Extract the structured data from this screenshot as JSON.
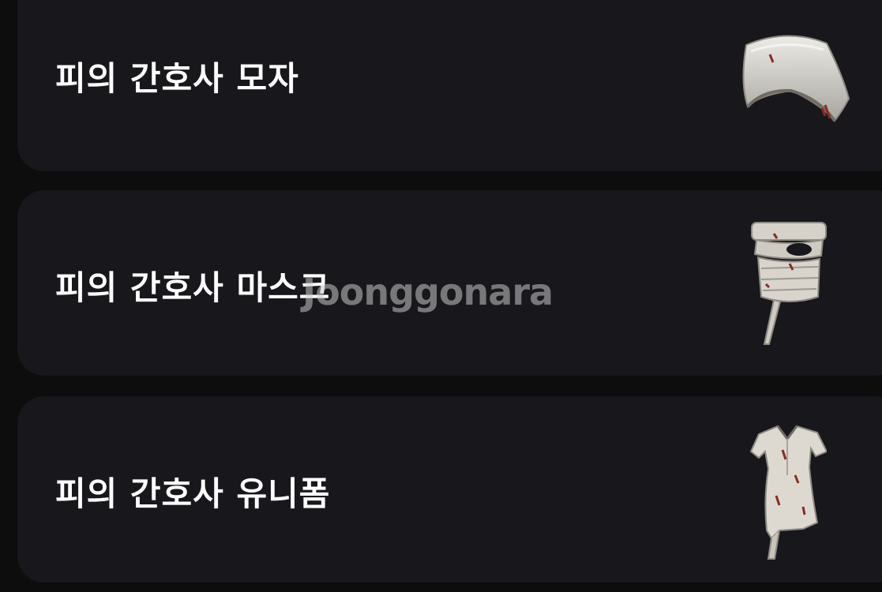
{
  "items": [
    {
      "name": "피의 간호사 모자",
      "icon": "nurse-hat-icon"
    },
    {
      "name": "피의 간호사 마스크",
      "icon": "bandage-mask-icon"
    },
    {
      "name": "피의 간호사 유니폼",
      "icon": "nurse-uniform-icon"
    }
  ],
  "watermark": "Joonggonara",
  "colors": {
    "background": "#0d0d0e",
    "card": "#17171c",
    "text": "#ffffff",
    "cloth": "#d9d6cf",
    "blood": "#8a2a22"
  }
}
